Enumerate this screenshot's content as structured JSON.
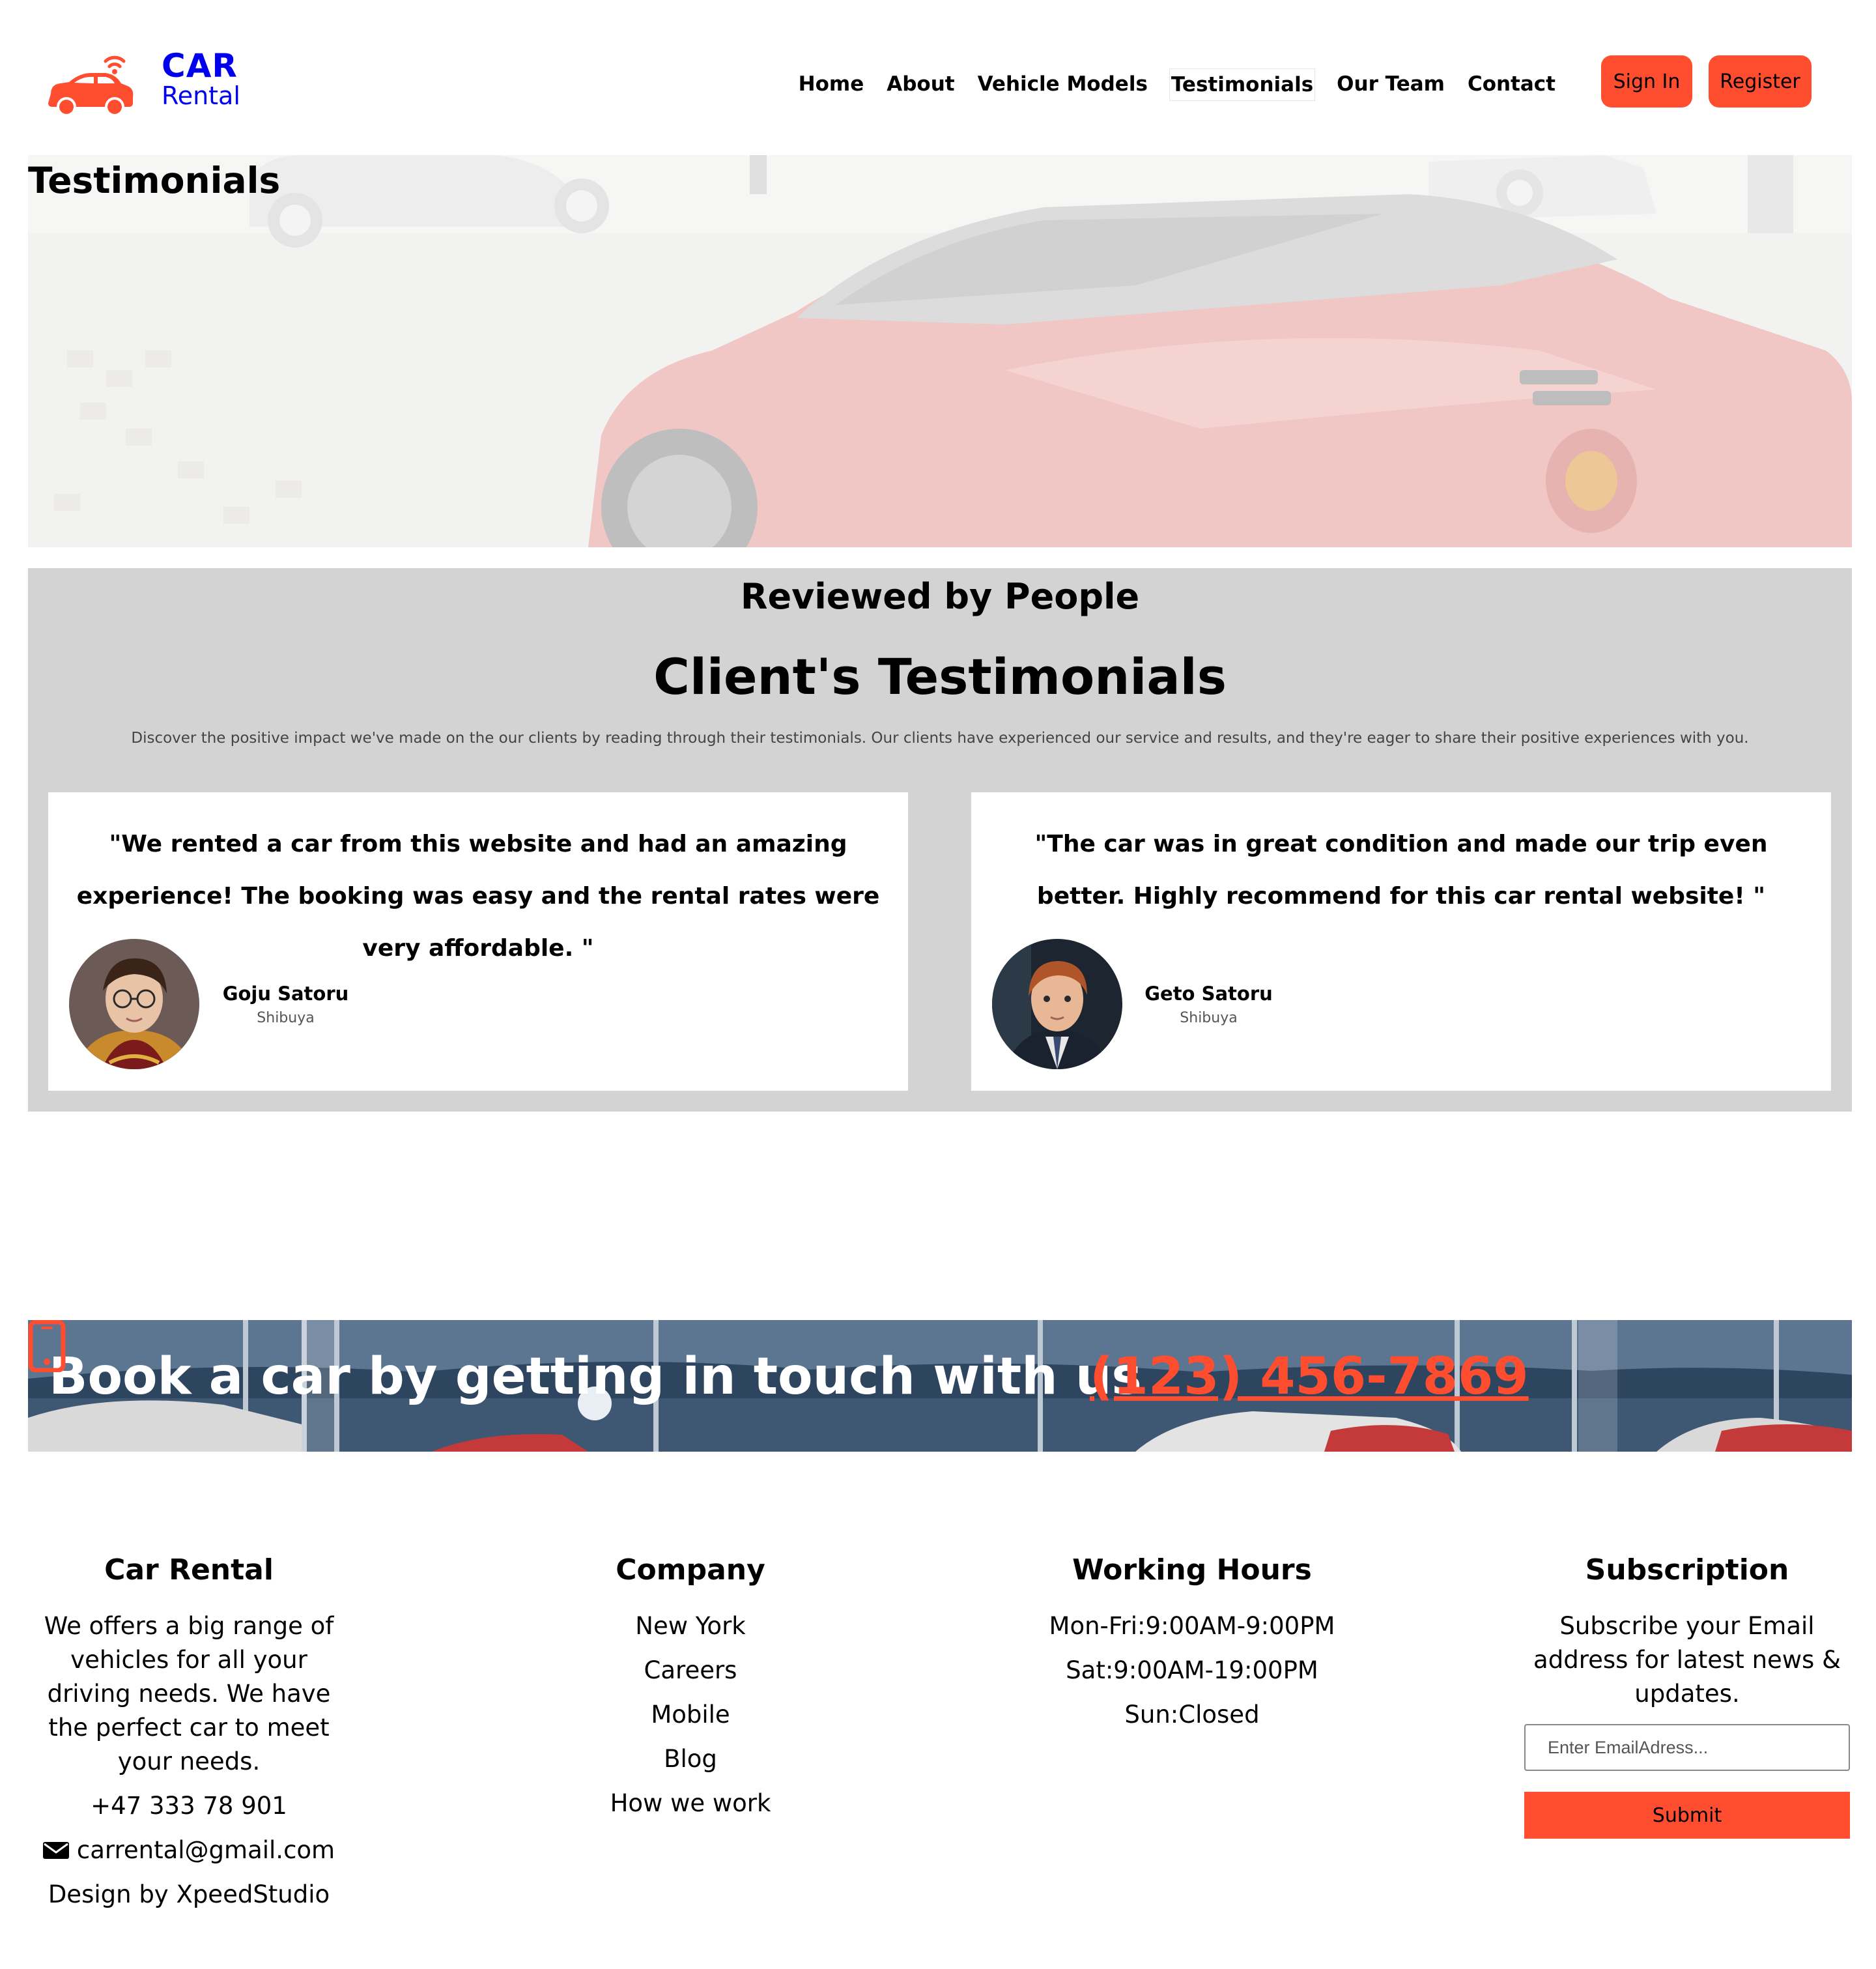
{
  "brand": {
    "name_top": "CAR",
    "name_bottom": "Rental",
    "accent_color": "#ff4d30"
  },
  "nav": {
    "items": [
      {
        "label": "Home"
      },
      {
        "label": "About"
      },
      {
        "label": "Vehicle Models"
      },
      {
        "label": "Testimonials",
        "active": true
      },
      {
        "label": "Our Team"
      },
      {
        "label": "Contact"
      }
    ],
    "sign_in": "Sign In",
    "register": "Register"
  },
  "hero": {
    "title": "Testimonials"
  },
  "testimonials": {
    "kicker": "Reviewed by People",
    "heading": "Client's Testimonials",
    "description": "Discover the positive impact we've made on the our clients by reading through their testimonials. Our clients have experienced our service and results, and they're eager to share their positive experiences with you.",
    "cards": [
      {
        "quote": "\"We rented a car from this website and had an amazing experience! The booking was easy and the rental rates were very affordable. \"",
        "name": "Goju Satoru",
        "place": "Shibuya"
      },
      {
        "quote": "\"The car was in great condition and made our trip even better. Highly recommend for this car rental website! \"",
        "name": "Geto Satoru",
        "place": "Shibuya"
      }
    ]
  },
  "banner": {
    "text": "Book a car by getting in touch with us",
    "phone": "(123) 456-7869",
    "phone_icon": "mobile-phone-icon"
  },
  "footer": {
    "about": {
      "title": "Car Rental",
      "description": "We offers a big range of vehicles for all your driving needs. We have the perfect car to meet your needs.",
      "phone": "+47 333 78 901",
      "email": "carrental@gmail.com",
      "credit": "Design by XpeedStudio"
    },
    "company": {
      "title": "Company",
      "links": [
        "New York",
        "Careers",
        "Mobile",
        "Blog",
        "How we work"
      ]
    },
    "hours": {
      "title": "Working Hours",
      "lines": [
        "Mon-Fri:9:00AM-9:00PM",
        "Sat:9:00AM-19:00PM",
        "Sun:Closed"
      ]
    },
    "subscription": {
      "title": "Subscription",
      "description": "Subscribe your Email address for latest news & updates.",
      "placeholder": "Enter EmailAdress...",
      "submit": "Submit"
    }
  }
}
